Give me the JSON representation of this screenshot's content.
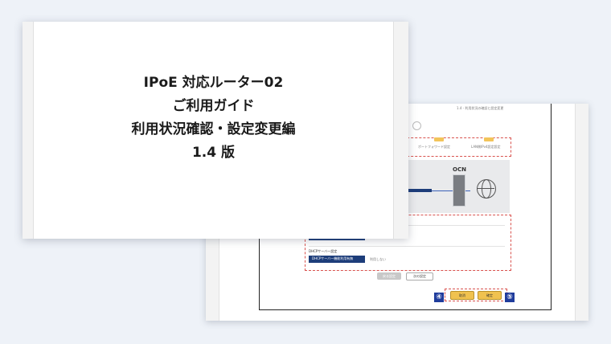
{
  "title_card": {
    "line1": "IPoE 対応ルーター02",
    "line2": "ご利用ガイド",
    "line3": "利用状況確認・設定変更編",
    "line4": "1.4 版"
  },
  "screenshot": {
    "header_note": "1.4 - 利用状況の確認と設定変更",
    "step_tab_port": "ポートフォワード設定",
    "step_tab_lan": "LAN側IPv4設定設定",
    "network_label": "OCN",
    "lan_ip_label": "LAN側IPアドレス",
    "dhcp_section": "DHCPサーバー設定",
    "dhcp_row_label": "DHCPサーバー機能利用有無",
    "dhcp_row_value": "利用しない",
    "btn_back": "戻る設定",
    "btn_next": "次の設定",
    "btn_cancel": "取消",
    "btn_confirm": "確定",
    "badge_4": "④",
    "badge_5": "⑤"
  },
  "colors": {
    "badge": "#1f3c9c",
    "highlight_box": "#d9534f",
    "confirm_button": "#f0c24f",
    "navy_row": "#1d3d7a"
  }
}
